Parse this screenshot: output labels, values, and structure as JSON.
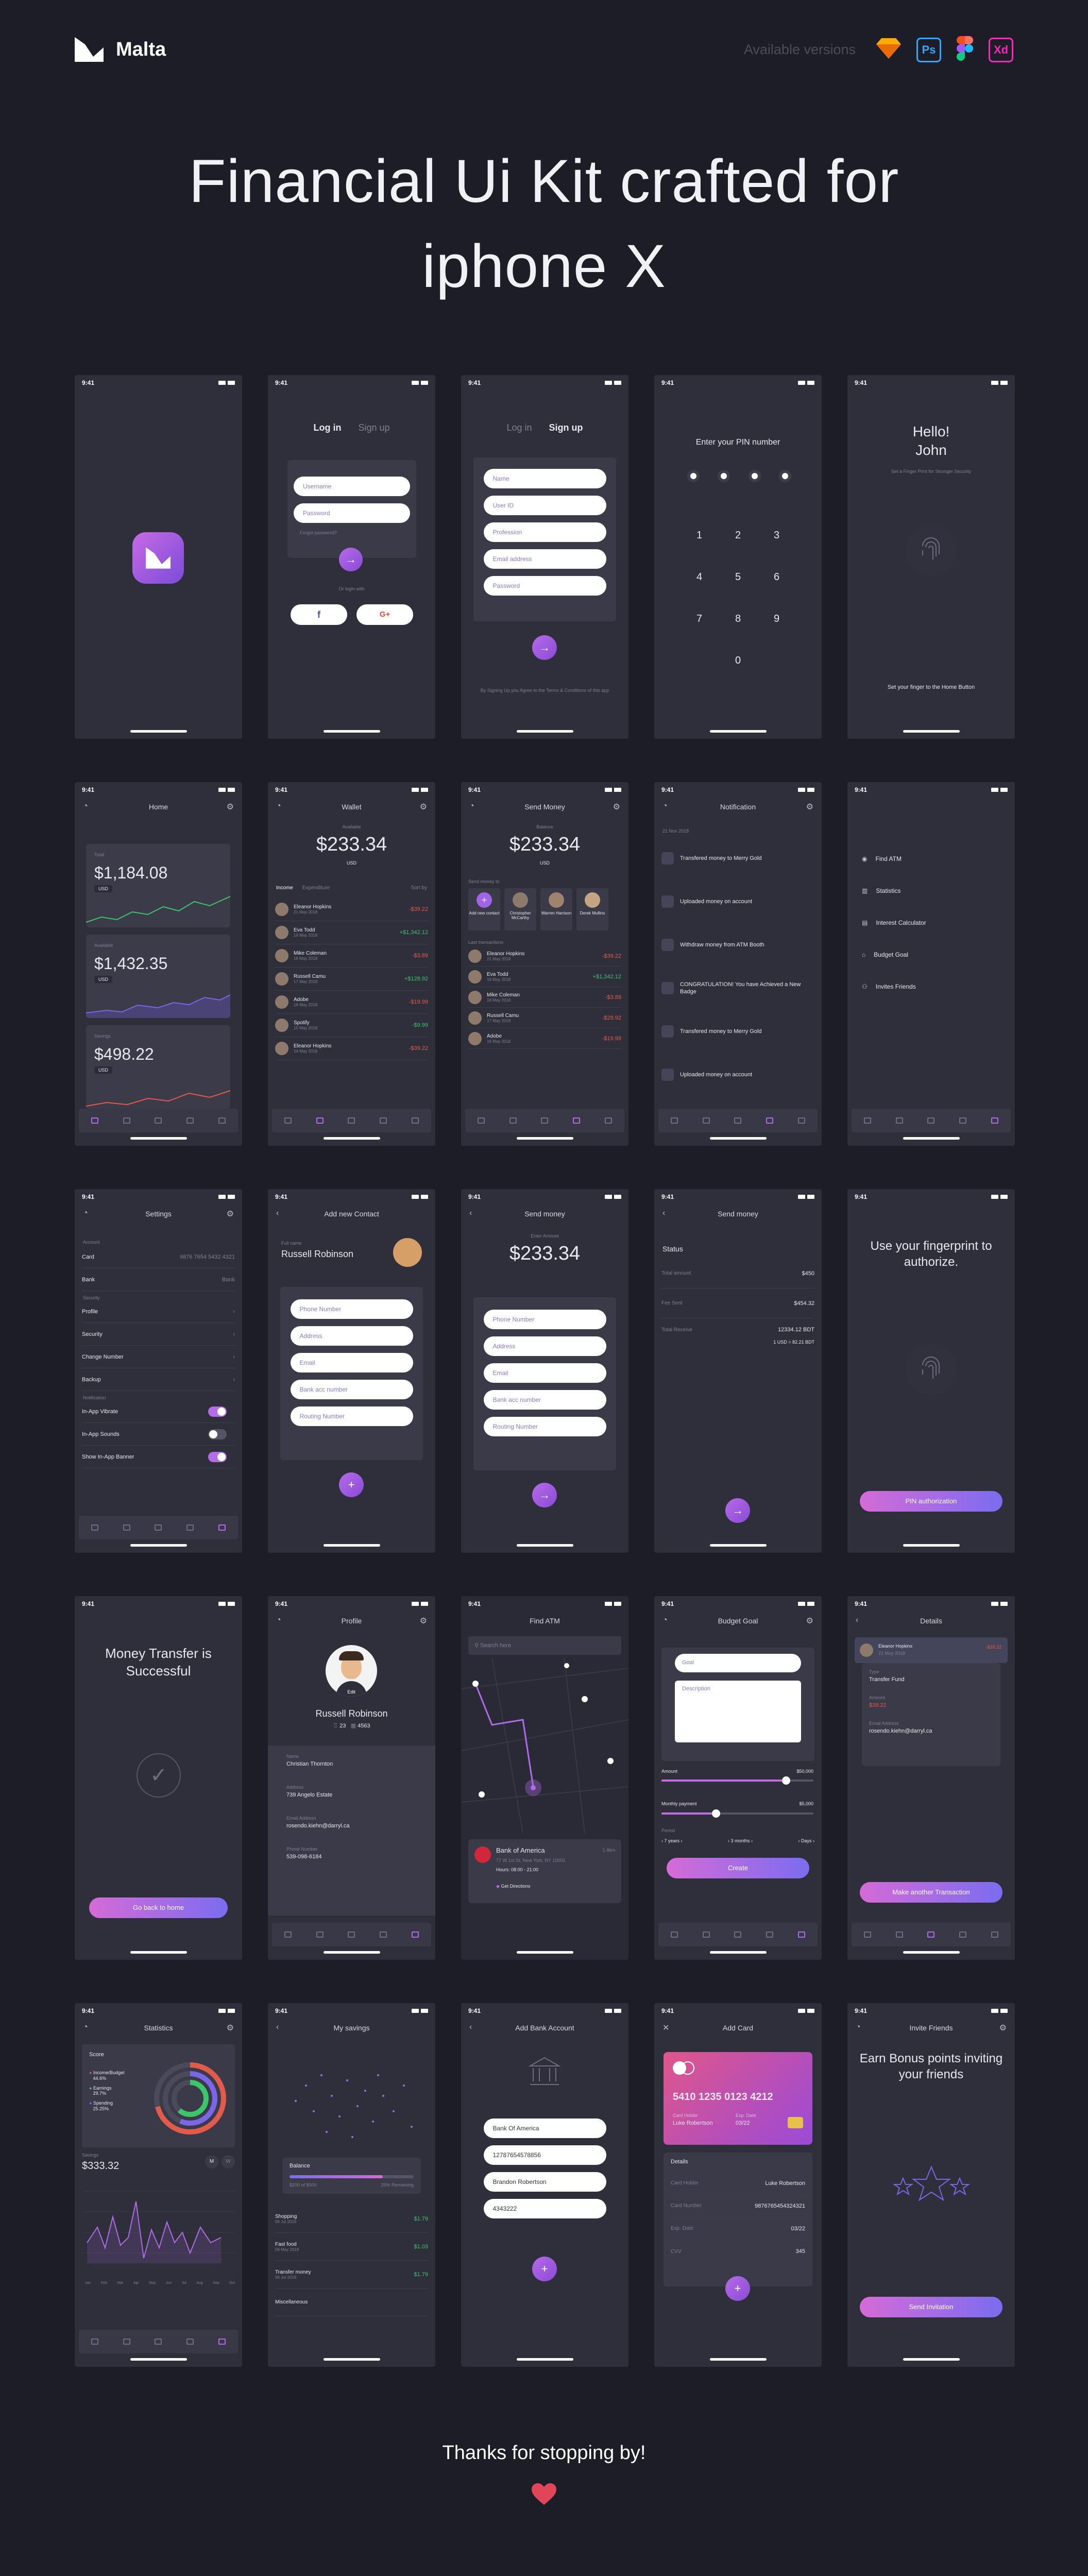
{
  "brand": {
    "name": "Malta"
  },
  "header": {
    "available_label": "Available versions",
    "tools": [
      "Sketch",
      "Ps",
      "Figma",
      "Xd"
    ]
  },
  "hero": {
    "line1": "Financial Ui Kit crafted for",
    "line2": "iphone X"
  },
  "status_time": "9:41",
  "screens": {
    "login": {
      "tab_login": "Log in",
      "tab_signup": "Sign up",
      "username": "Username",
      "password": "Password",
      "forgot": "Forgot password?",
      "or": "Or login with",
      "facebook": "f",
      "google": "G+"
    },
    "signup": {
      "tab_login": "Log in",
      "tab_signup": "Sign up",
      "fields": [
        "Name",
        "User ID",
        "Profession",
        "Email address",
        "Password"
      ],
      "terms": "By Signing Up,you Agree to the Terms & Conditions of this app"
    },
    "pin": {
      "title": "Enter your PIN number",
      "keys": [
        "1",
        "2",
        "3",
        "4",
        "5",
        "6",
        "7",
        "8",
        "9",
        "0"
      ]
    },
    "hello": {
      "title1": "Hello!",
      "title2": "John",
      "subtitle": "Set a Finger Print for Stronger Security",
      "hint": "Set your finger to the Home Button"
    },
    "home": {
      "title": "Home",
      "cards": [
        {
          "label": "Total",
          "value": "$1,184.08",
          "cur": "USD"
        },
        {
          "label": "Available",
          "value": "$1,432.35",
          "cur": "USD"
        },
        {
          "label": "Savings",
          "value": "$498.22",
          "cur": "USD"
        }
      ]
    },
    "wallet": {
      "title": "Wallet",
      "label": "Available",
      "balance": "$233.34",
      "cur": "USD",
      "tabs": [
        "Income",
        "Expenditure"
      ],
      "sort": "Sort by",
      "rows": [
        {
          "name": "Eleanor Hopkins",
          "date": "21 May 2018",
          "amount": "-$39.22",
          "type": "neg"
        },
        {
          "name": "Eva Todd",
          "date": "19 May 2018",
          "amount": "+$1,342.12",
          "type": "pos"
        },
        {
          "name": "Mike Coleman",
          "date": "18 May 2018",
          "amount": "-$3.89",
          "type": "neg"
        },
        {
          "name": "Russell Camu",
          "date": "17 May 2018",
          "amount": "+$128.92",
          "type": "pos"
        },
        {
          "name": "Adobe",
          "date": "16 May 2018",
          "amount": "-$19.99",
          "type": "neg"
        },
        {
          "name": "Spotify",
          "date": "15 May 2018",
          "amount": "-$9.99",
          "type": "pos"
        },
        {
          "name": "Eleanor Hopkins",
          "date": "14 May 2018",
          "amount": "-$39.22",
          "type": "neg"
        }
      ]
    },
    "send": {
      "title": "Send Money",
      "label": "Balance",
      "balance": "$233.34",
      "cur": "USD",
      "recent_label": "Send money to",
      "contacts": [
        "Add new contact",
        "Christopher McCarthy",
        "Warren Harrison",
        "Derek Mullins"
      ],
      "last_label": "Last transactions",
      "rows": [
        {
          "name": "Eleanor Hopkins",
          "date": "21 May 2018",
          "amount": "-$39.22",
          "type": "neg"
        },
        {
          "name": "Eva Todd",
          "date": "19 May 2018",
          "amount": "+$1,342.12",
          "type": "pos"
        },
        {
          "name": "Mike Coleman",
          "date": "18 May 2018",
          "amount": "-$3.89",
          "type": "neg"
        },
        {
          "name": "Russell Camu",
          "date": "17 May 2018",
          "amount": "-$28.92",
          "type": "neg"
        },
        {
          "name": "Adobe",
          "date": "16 May 2018",
          "amount": "-$19.99",
          "type": "neg"
        }
      ]
    },
    "notification": {
      "title": "Notification",
      "date": "21 Nov 2018",
      "items": [
        "Transfered money to Merry Gold",
        "Uploaded money on account",
        "Withdraw money from ATM Booth",
        "CONGRATULATION! You have Achieved a New Badge",
        "Transfered money to Merry Gold",
        "Uploaded money on account"
      ]
    },
    "menu": {
      "items": [
        "Find ATM",
        "Statistics",
        "Interest Calculator",
        "Budget Goal",
        "Invites Friends"
      ]
    },
    "settings": {
      "title": "Settings",
      "account_label": "Account",
      "card": "Card",
      "card_value": "9876 7654 5432 4321",
      "bank": "Bank",
      "bank_value": "Bank",
      "security_label": "Security",
      "items": [
        "Profile",
        "Security",
        "Change Number",
        "Backup"
      ],
      "notif_label": "Notification",
      "toggles": [
        "In-App Vibrate",
        "In-App Sounds",
        "Show In-App Banner"
      ]
    },
    "add_contact": {
      "title": "Add new Contact",
      "label": "Full name",
      "name": "Russell Robinson",
      "fields": [
        "Phone Number",
        "Address",
        "Email",
        "Bank acc number",
        "Routing Number"
      ]
    },
    "send2": {
      "title": "Send money",
      "label": "Enter Amount",
      "amount": "$233.34",
      "fields": [
        "Phone Number",
        "Address",
        "Email",
        "Bank acc number",
        "Routing Number"
      ]
    },
    "send3": {
      "title": "Send money",
      "status": "Status",
      "rows": [
        {
          "k": "Total amount",
          "v": "$450"
        },
        {
          "k": "Fee Sent",
          "v": "$454.32"
        },
        {
          "k": "Total Receive",
          "v": "12334.12 BDT"
        },
        {
          "k": "",
          "v": "1 USD = 82.21 BDT"
        }
      ]
    },
    "fingerprint": {
      "title": "Use your fingerprint to authorize.",
      "button": "PIN authorization"
    },
    "success": {
      "title": "Money Transfer is Successful",
      "button": "Go back to home"
    },
    "profile": {
      "title": "Profile",
      "edit": "Edit",
      "name": "Russell Robinson",
      "stat1": "23",
      "stat2": "4563",
      "fields": [
        {
          "k": "Name",
          "v": "Christian Thornton"
        },
        {
          "k": "Address",
          "v": "739 Angelo Estate"
        },
        {
          "k": "Email Address",
          "v": "rosendo.kiehn@darryl.ca"
        },
        {
          "k": "Phone Number",
          "v": "539-098-6184"
        }
      ]
    },
    "atm": {
      "title": "Find ATM",
      "search": "Search here",
      "bank": "Bank of America",
      "address": "77 W 1st St, New York, NY 10001",
      "hours": "Hours: 08:00 - 21:00",
      "distance": "1.4km",
      "directions": "Get Directions"
    },
    "budget": {
      "title": "Budget Goal",
      "goal": "Goal",
      "description": "Description",
      "amount_label": "Amount",
      "amount_value": "$50,000",
      "monthly_label": "Monthly payment",
      "monthly_value": "$5,000",
      "amount_level": 0.82,
      "monthly_level": 0.36,
      "period": "Period",
      "opts": [
        "7 years",
        "3 months",
        "Days"
      ],
      "button": "Create"
    },
    "details": {
      "title": "Details",
      "name": "Eleanor Hopkins",
      "date": "21 May 2018",
      "amount_top": "-$39.22",
      "fields": [
        {
          "k": "Type",
          "v": "Transfer Fund"
        },
        {
          "k": "Amount",
          "v": "$39.22"
        },
        {
          "k": "Email Address",
          "v": "rosendo.kiehn@darryl.ca"
        }
      ],
      "button": "Make another Transaction"
    },
    "statistics": {
      "title": "Statistics",
      "score": "Score",
      "legend": [
        {
          "name": "Income/Budget",
          "v": "44.6%"
        },
        {
          "name": "Earnings",
          "v": "29.7%"
        },
        {
          "name": "Spending",
          "v": "25.25%"
        }
      ],
      "label": "Savings",
      "value": "$333.32",
      "toggle": [
        "W",
        "M"
      ],
      "months": [
        "Jan",
        "Feb",
        "Mar",
        "Apr",
        "May",
        "Jun",
        "Jul",
        "Aug",
        "Sep",
        "Oct"
      ]
    },
    "savings": {
      "title": "My savings",
      "balance_label": "Balance",
      "b1": "$200 of $500",
      "b2": "25% Remaining",
      "rows": [
        {
          "name": "Shopping",
          "date": "06 Jul 2018",
          "saved": "$1.79"
        },
        {
          "name": "Fast food",
          "date": "06 May 2018",
          "saved": "$1.03"
        },
        {
          "name": "Transfer money",
          "date": "06 Jul 2018",
          "saved": "$1.79"
        },
        {
          "name": "Miscellaneous",
          "date": "",
          "saved": ""
        }
      ]
    },
    "add_bank": {
      "title": "Add Bank Account",
      "fields": [
        "Bank Of America",
        "12787654578856",
        "Brandon Robertson",
        "4343222"
      ]
    },
    "add_card": {
      "title": "Add Card",
      "card_number": "5410 1235 0123 4212",
      "holder_label": "Card Holder",
      "holder": "Luke Robertson",
      "exp_label": "Exp. Date",
      "exp": "03/22",
      "details": "Details",
      "rows": [
        {
          "k": "Card Holder",
          "v": "Luke Robertson"
        },
        {
          "k": "Card Number",
          "v": "9876765454324321"
        },
        {
          "k": "Exp. Date",
          "v": "03/22"
        },
        {
          "k": "CVV",
          "v": "345"
        }
      ]
    },
    "invite": {
      "title": "Invite Friends",
      "heading": "Earn Bonus points inviting your friends",
      "button": "Send Invitation"
    }
  },
  "footer": {
    "text": "Thanks for stopping by!"
  },
  "colors": {
    "bg": "#1d1d27",
    "phone": "#2f2f3c",
    "accent": "#b06ce8",
    "accent2": "#7b6cf0",
    "heart": "#e0455a"
  }
}
